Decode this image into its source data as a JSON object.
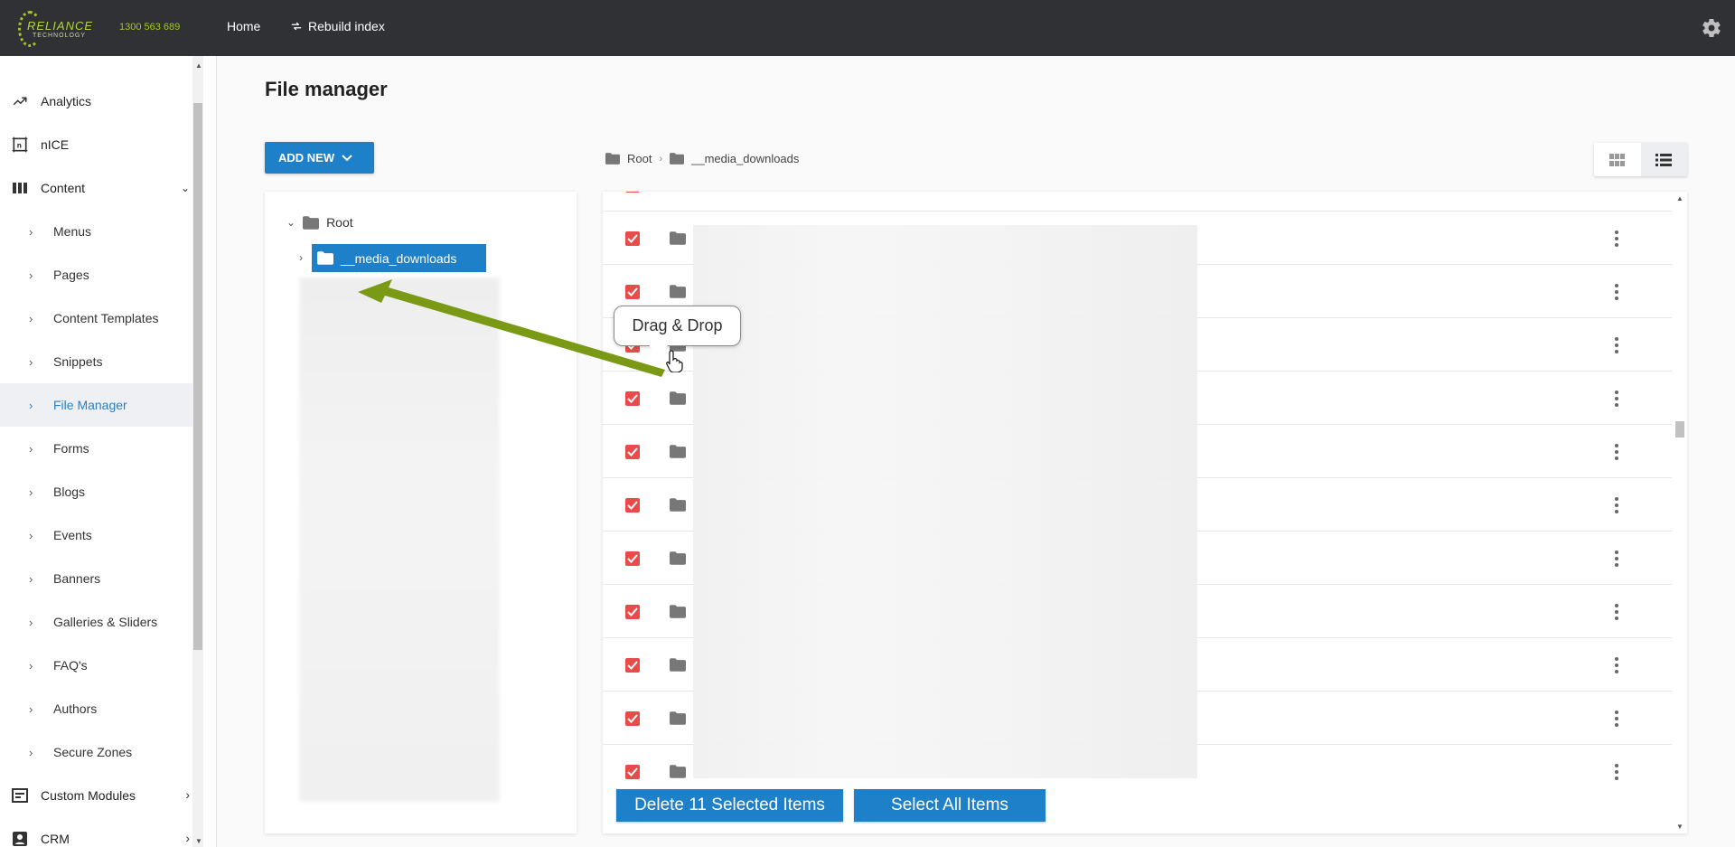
{
  "header": {
    "logo_text": "RELIANCE",
    "logo_sub": "TECHNOLOGY",
    "phone": "1300 563 689",
    "nav_home": "Home",
    "nav_rebuild": "Rebuild index"
  },
  "sidebar": {
    "top_items": [
      {
        "label": "Analytics",
        "icon": "trending-up-icon"
      },
      {
        "label": "nICE",
        "icon": "nice-icon"
      },
      {
        "label": "Content",
        "icon": "columns-icon",
        "expanded": true
      }
    ],
    "sub_items": [
      {
        "label": "Menus"
      },
      {
        "label": "Pages"
      },
      {
        "label": "Content Templates"
      },
      {
        "label": "Snippets"
      },
      {
        "label": "File Manager",
        "active": true
      },
      {
        "label": "Forms"
      },
      {
        "label": "Blogs"
      },
      {
        "label": "Events"
      },
      {
        "label": "Banners"
      },
      {
        "label": "Galleries & Sliders"
      },
      {
        "label": "FAQ's"
      },
      {
        "label": "Authors"
      },
      {
        "label": "Secure Zones"
      }
    ],
    "bottom_items": [
      {
        "label": "Custom Modules",
        "icon": "modules-icon"
      },
      {
        "label": "CRM",
        "icon": "contact-card-icon"
      }
    ]
  },
  "main": {
    "title": "File manager",
    "add_new_label": "ADD NEW",
    "tree": {
      "root_label": "Root",
      "selected_label": "__media_downloads"
    },
    "breadcrumb": {
      "root": "Root",
      "current": "__media_downloads"
    },
    "view_modes": [
      "grid-view-icon",
      "list-view-icon"
    ],
    "active_view": "list",
    "row_count_visible": 11,
    "actions": {
      "delete_label": "Delete 11 Selected Items",
      "select_all_label": "Select All Items"
    }
  },
  "annotation": {
    "tooltip": "Drag & Drop"
  },
  "colors": {
    "topbar": "#2f3135",
    "accent": "#1e80c8",
    "checkbox": "#e94b4b",
    "logo_green": "#a6c425",
    "arrow_green": "#7a9a16"
  }
}
